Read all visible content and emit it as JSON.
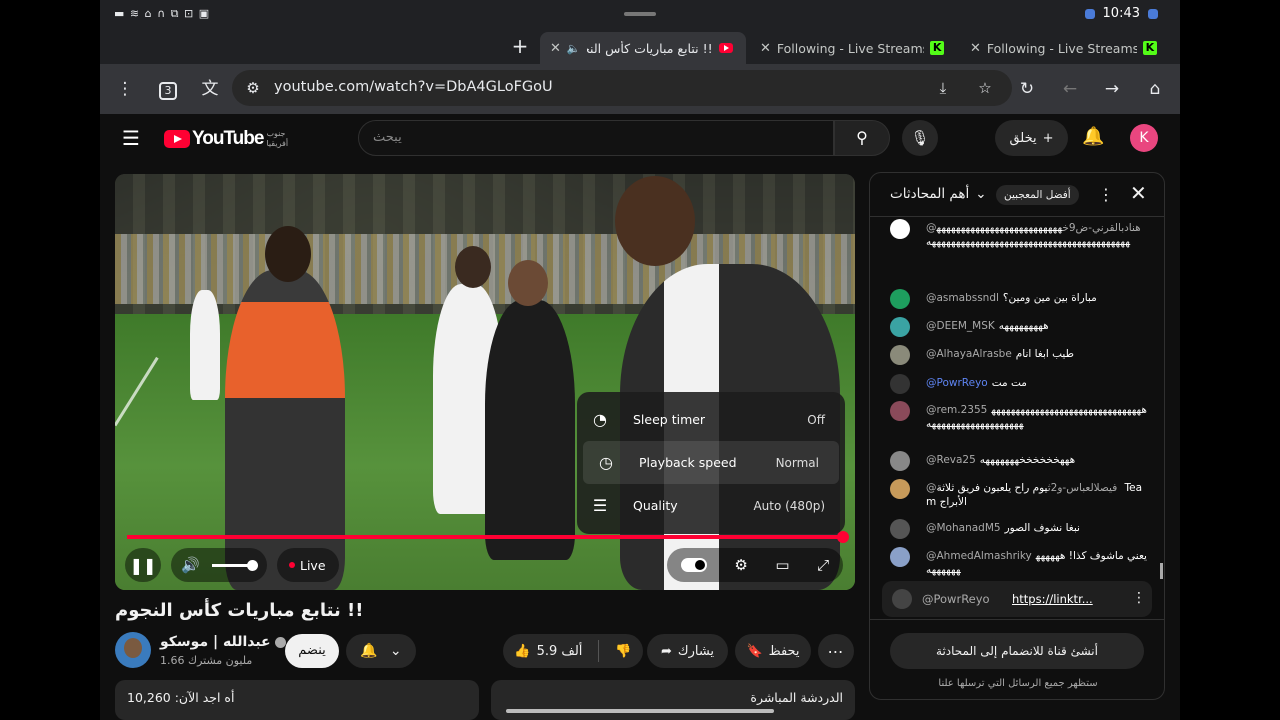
{
  "status_bar": {
    "time": "10:43",
    "left_icons": "▬ ≋ ⌂ ∩ ⧉ ⊡ ▣"
  },
  "tabs": [
    {
      "title": "!! نتابع مباريات كأس النجوم -",
      "active": true
    },
    {
      "title": "Following - Live Streams on",
      "active": false
    },
    {
      "title": "Following - Live Streams on",
      "active": false
    }
  ],
  "toolbar": {
    "tab_count": "3",
    "url": "youtube.com/watch?v=DbA4GLoFGoU"
  },
  "youtube": {
    "logo": "YouTube",
    "country": "جنوب أفريقيا",
    "search_placeholder": "يبحث",
    "create_label": "يخلق",
    "avatar_letter": "K"
  },
  "player": {
    "settings": [
      {
        "label": "Sleep timer",
        "value": "Off",
        "icon": "timer-icon"
      },
      {
        "label": "Playback speed",
        "value": "Normal",
        "icon": "speed-icon"
      },
      {
        "label": "Quality",
        "value": "Auto (480p)",
        "icon": "sliders-icon"
      }
    ],
    "live_label": "Live",
    "progress": 1.0
  },
  "video": {
    "title": "!! نتابع مباريات كأس النجوم",
    "channel_name": "عبدالله | موسكو",
    "subscribers": "1.66 مليون مشترك",
    "join_label": "ينضم",
    "likes": "5.9 ألف",
    "share_label": "يشارك",
    "save_label": "يحفظ",
    "card1_text": "أه اجد الآن: 10,260",
    "card2_text": "الدردشة المباشرة"
  },
  "chat": {
    "title": "أهم المحادثات",
    "badge": "أفضل المعجبين",
    "messages": [
      {
        "author": "@هنادبالقرني-ض9خ",
        "text": "هههههههههههههههههههههههههههههههههههههههههههههههههههههههههههههههههههه",
        "avatar_color": "#ffffff",
        "mod": false
      },
      {
        "author": "@asmabssndl",
        "text": "مباراة بين مين ومين؟",
        "avatar_color": "#1e9e5e",
        "mod": false
      },
      {
        "author": "@DEEM_MSK",
        "text": "هههههههههه",
        "avatar_color": "#3aa3a3",
        "mod": false
      },
      {
        "author": "@AlhayaAlrasbe",
        "text": "طيب ابغا انام",
        "avatar_color": "#8a8a7a",
        "mod": false
      },
      {
        "author": "@PowrReyo",
        "text": "مت مت",
        "avatar_color": "#333333",
        "mod": true
      },
      {
        "author": "@rem.2355",
        "text": "هههههههههههههههههههههههههههههههههههههههههههههههههههه",
        "avatar_color": "#8a4a5a",
        "mod": false
      },
      {
        "author": "@Reva25",
        "text": "هههخخخخخخهههههههه",
        "avatar_color": "#888888",
        "mod": false
      },
      {
        "author": "@فيصلالعباس-و2ث",
        "text": "يوم راح يلعبون فريق ثلاثة Team الأبراج",
        "avatar_color": "#c79a5a",
        "mod": false
      },
      {
        "author": "@MohanadM5",
        "text": "نبغا نشوف الصور",
        "avatar_color": "#555555",
        "mod": false
      },
      {
        "author": "@AhmedAlmashriky",
        "text": "يعني ماشوف كذا! ههههههههههههه",
        "avatar_color": "#8aa0c8",
        "mod": false
      }
    ],
    "pinned_author": "@PowrReyo",
    "pinned_link": "https://linktr...",
    "join_chat_label": "أنشئ قناة للانضمام إلى المحادثة",
    "footer_note": "ستظهر جميع الرسائل التي ترسلها علنا"
  }
}
